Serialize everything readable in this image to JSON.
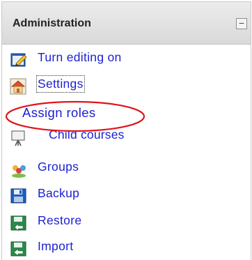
{
  "block": {
    "title": "Administration",
    "collapse_symbol": "−"
  },
  "items": [
    {
      "label": "Turn editing on",
      "icon": "edit-pencil-icon"
    },
    {
      "label": "Settings",
      "icon": "settings-house-icon"
    },
    {
      "label": "Child courses",
      "icon": "child-courses-icon"
    },
    {
      "label": "Groups",
      "icon": "groups-icon"
    },
    {
      "label": "Backup",
      "icon": "backup-disk-icon"
    },
    {
      "label": "Restore",
      "icon": "restore-icon"
    },
    {
      "label": "Import",
      "icon": "import-icon"
    }
  ],
  "annotation": {
    "label": "Assign roles",
    "circle_color": "#e0141a"
  },
  "colors": {
    "link": "#1b1fd1",
    "header_bg": "#dedede"
  }
}
